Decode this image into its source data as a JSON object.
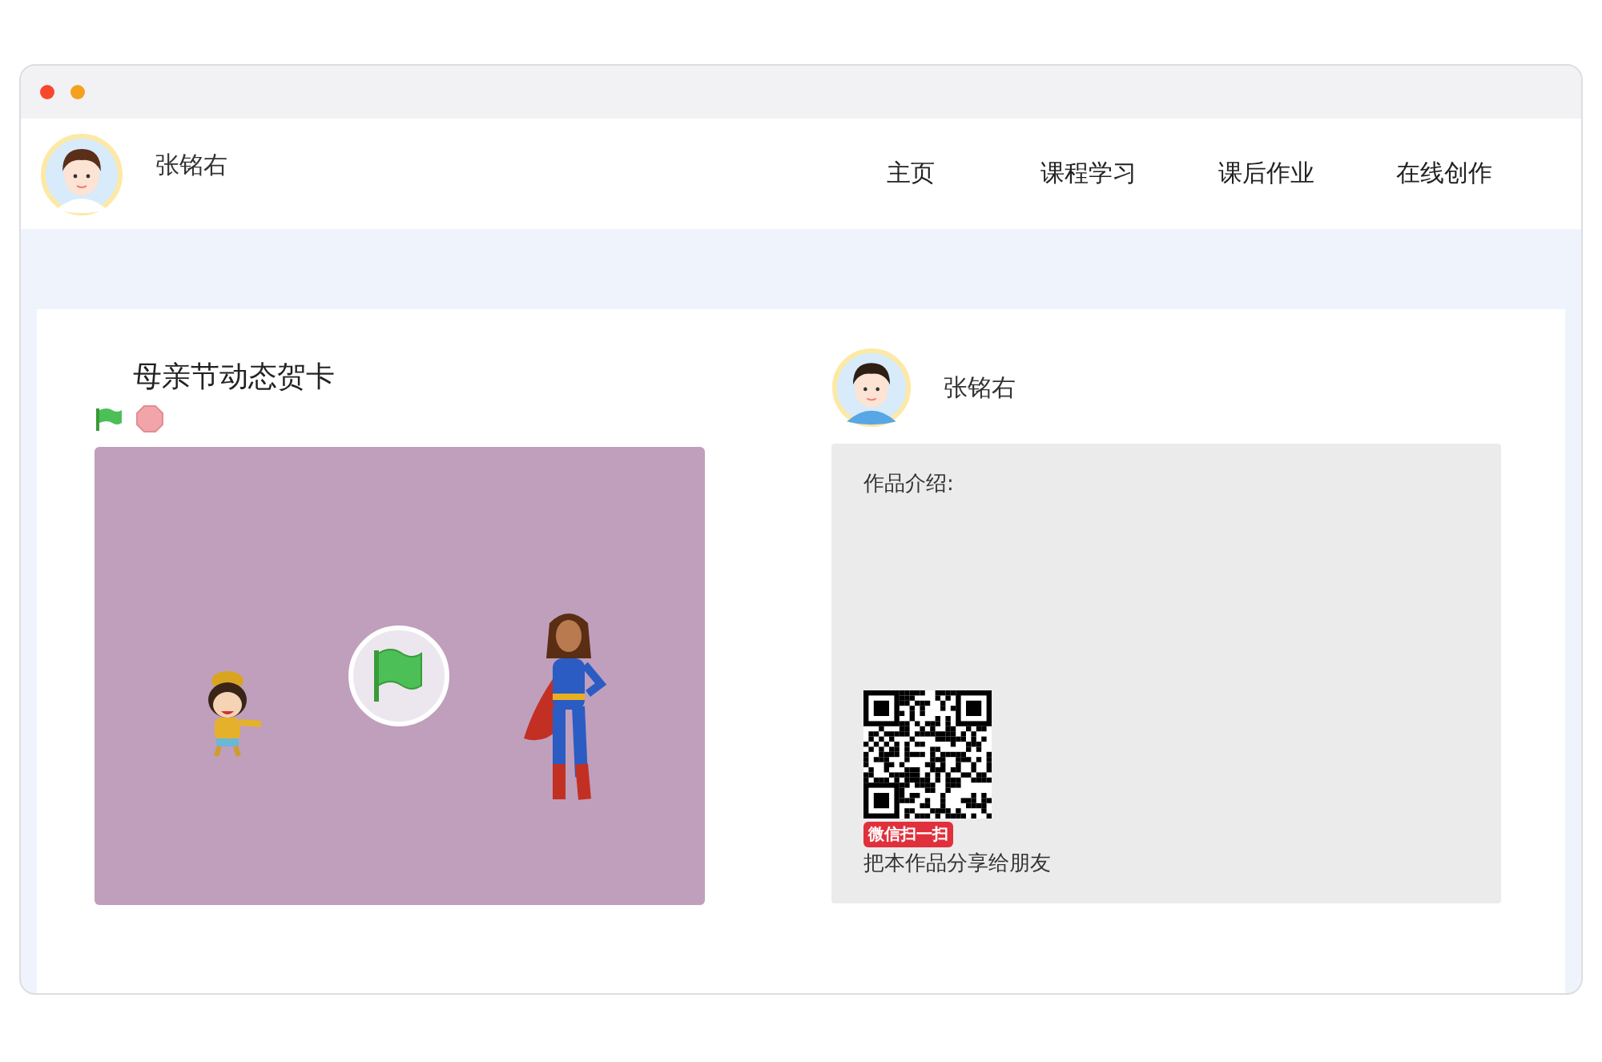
{
  "header": {
    "user_name": "张铭右",
    "nav": [
      {
        "label": "主页"
      },
      {
        "label": "课程学习"
      },
      {
        "label": "课后作业"
      },
      {
        "label": "在线创作"
      }
    ]
  },
  "project": {
    "title": "母亲节动态贺卡"
  },
  "author": {
    "name": "张铭右"
  },
  "info": {
    "intro_label": "作品介绍:",
    "qr_badge": "微信扫一扫",
    "share_text": "把本作品分享给朋友"
  }
}
